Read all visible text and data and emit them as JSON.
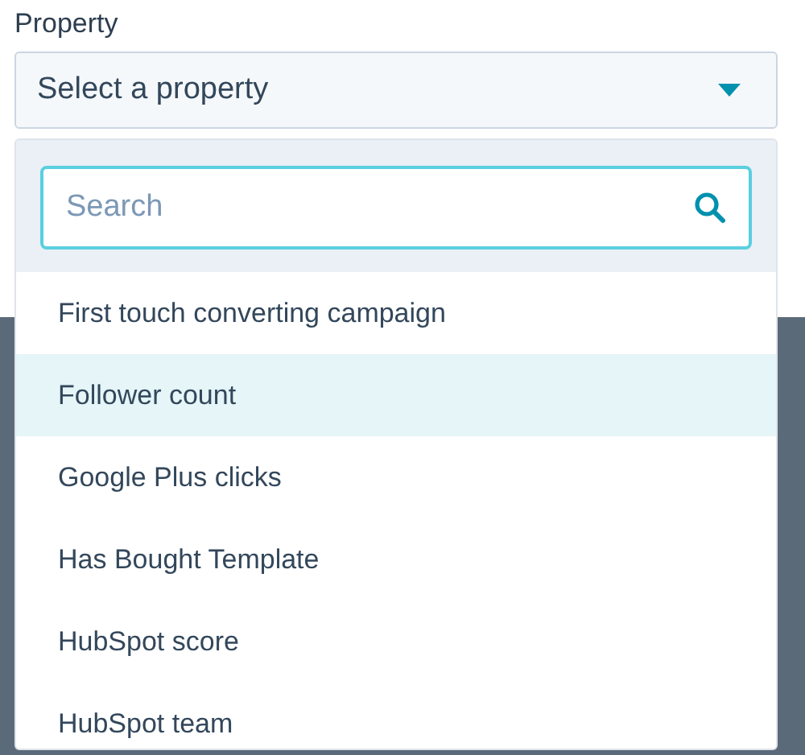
{
  "field": {
    "label": "Property",
    "select": {
      "placeholder": "Select a property",
      "expanded": true
    }
  },
  "search": {
    "placeholder": "Search"
  },
  "options": [
    {
      "label": "First touch converting campaign",
      "selected": false
    },
    {
      "label": "Follower count",
      "selected": true
    },
    {
      "label": "Google Plus clicks",
      "selected": false
    },
    {
      "label": "Has Bought Template",
      "selected": false
    },
    {
      "label": "HubSpot score",
      "selected": false
    },
    {
      "label": "HubSpot team",
      "selected": false
    }
  ]
}
